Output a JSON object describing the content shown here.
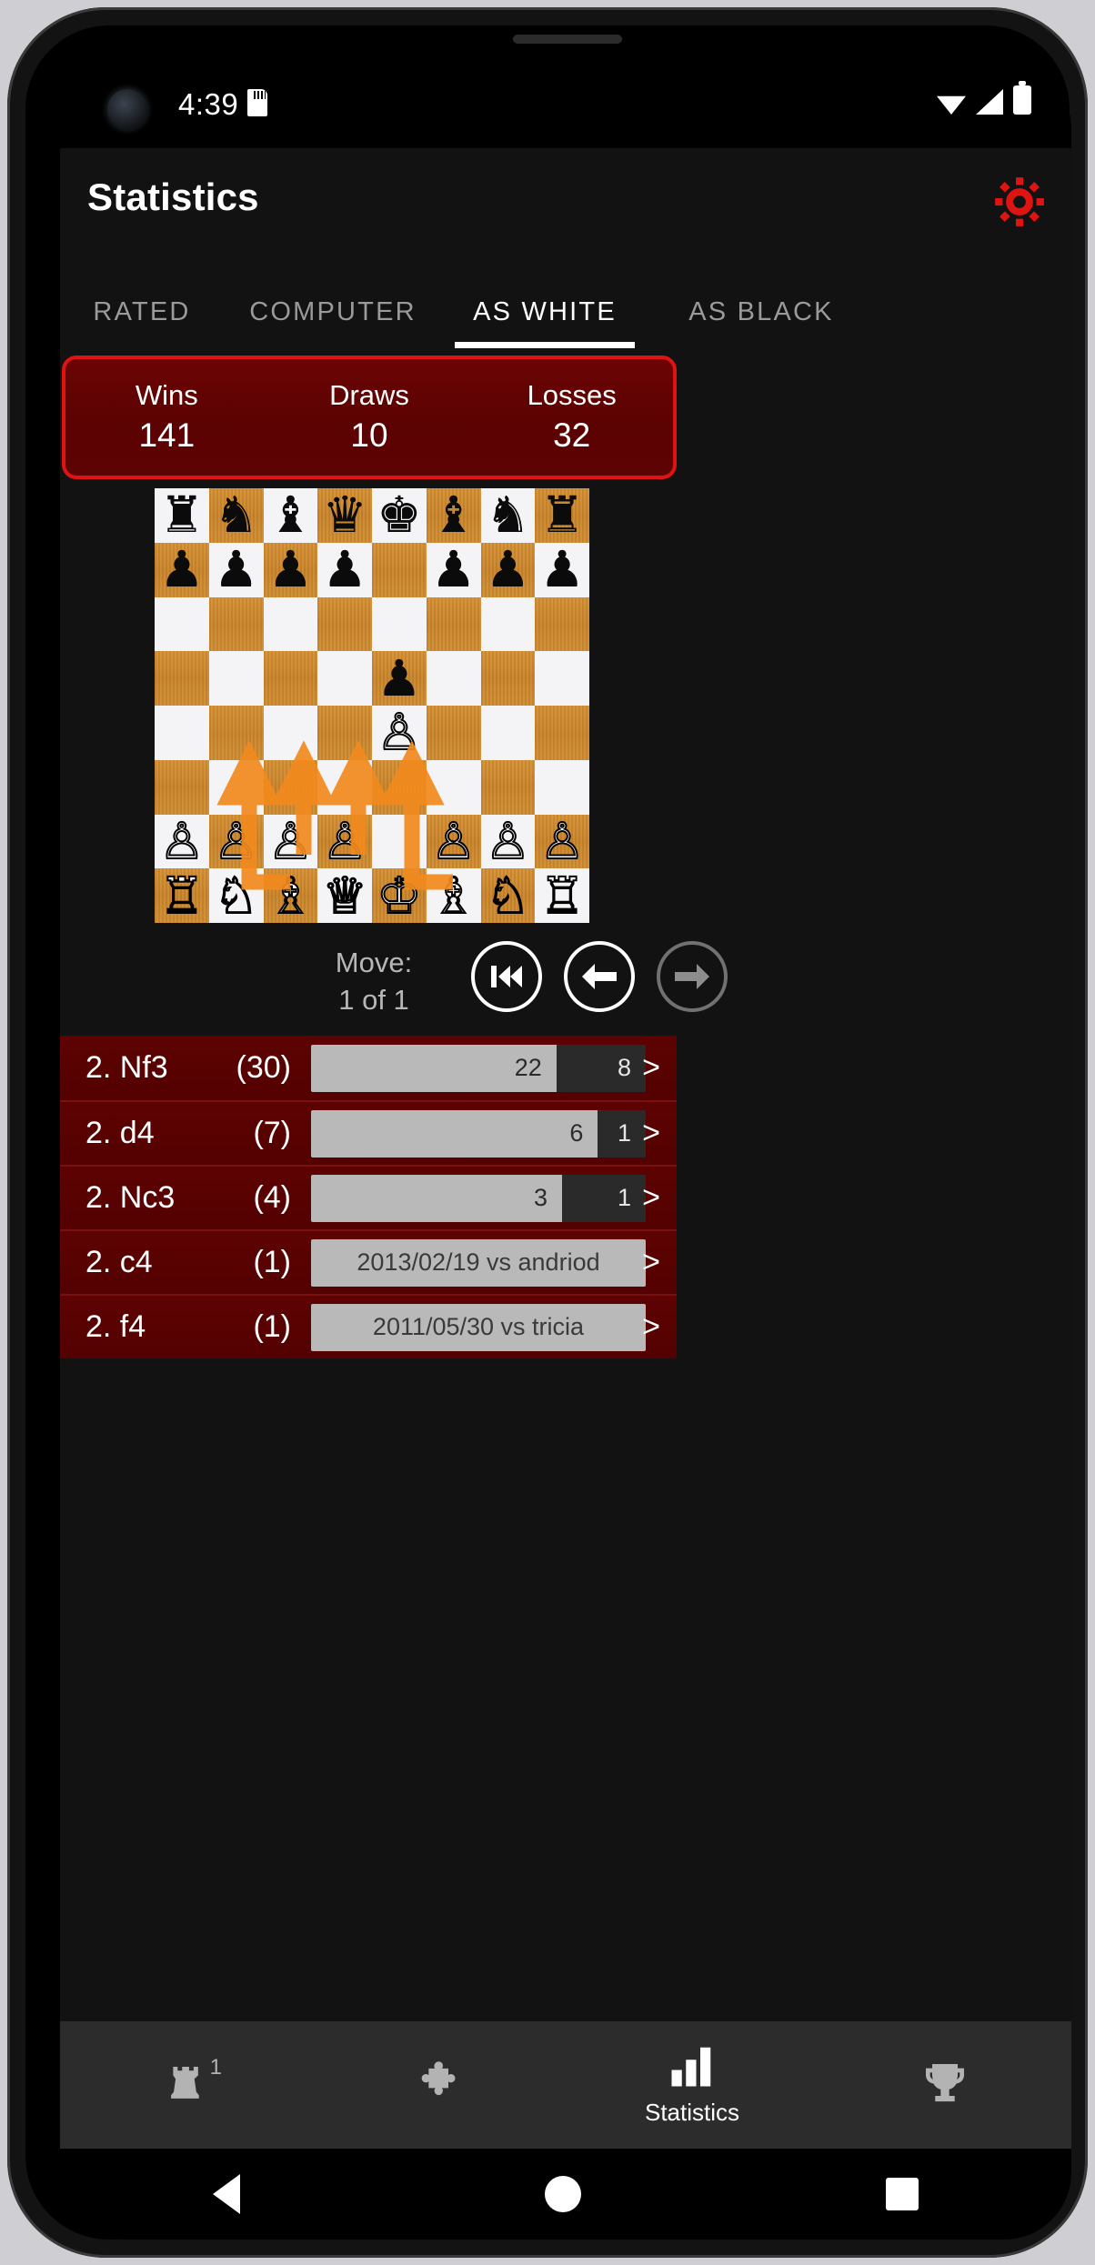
{
  "status_bar": {
    "time": "4:39",
    "icons": [
      "camera-lens",
      "sd-card-icon",
      "wifi-icon",
      "signal-icon",
      "battery-icon"
    ]
  },
  "app_bar": {
    "title": "Statistics",
    "settings_icon": "gear-icon",
    "accent_color": "#e01313"
  },
  "tabs": [
    {
      "label": "RATED",
      "active": false
    },
    {
      "label": "COMPUTER",
      "active": false
    },
    {
      "label": "AS WHITE",
      "active": true
    },
    {
      "label": "AS BLACK",
      "active": false
    }
  ],
  "stats": {
    "wins_label": "Wins",
    "wins_value": "141",
    "draws_label": "Draws",
    "draws_value": "10",
    "losses_label": "Losses",
    "losses_value": "32",
    "border_color": "#e01313",
    "background_color": "#5e0303"
  },
  "board": {
    "light_square_color": "#f4f4f6",
    "dark_square_color": "#cf8b2e",
    "arrow_color": "#f28a1e",
    "rows": [
      [
        "r",
        "n",
        "b",
        "q",
        "k",
        "b",
        "n",
        "r"
      ],
      [
        "p",
        "p",
        "p",
        "p",
        "",
        "p",
        "p",
        "p"
      ],
      [
        "",
        "",
        "",
        "",
        "",
        "",
        "",
        ""
      ],
      [
        "",
        "",
        "",
        "",
        "p",
        "",
        "",
        ""
      ],
      [
        "",
        "",
        "",
        "",
        "P",
        "",
        "",
        ""
      ],
      [
        "",
        "",
        "",
        "",
        "",
        "",
        "",
        ""
      ],
      [
        "P",
        "P",
        "P",
        "P",
        "",
        "P",
        "P",
        "P"
      ],
      [
        "R",
        "N",
        "B",
        "Q",
        "K",
        "B",
        "N",
        "R"
      ]
    ],
    "arrows": [
      {
        "from": "b1",
        "to": "c3"
      },
      {
        "from": "d2",
        "to": "d4"
      },
      {
        "from": "c2",
        "to": "c4"
      },
      {
        "from": "g1",
        "to": "f3"
      }
    ]
  },
  "move_nav": {
    "label_line1": "Move:",
    "label_line2": "1 of 1",
    "buttons": [
      {
        "name": "skip-to-start-icon",
        "enabled": true
      },
      {
        "name": "arrow-left-icon",
        "enabled": true
      },
      {
        "name": "arrow-right-icon",
        "enabled": false
      }
    ]
  },
  "move_list": [
    {
      "move": "2. Nf3",
      "count": "(30)",
      "kind": "bars",
      "win": "22",
      "loss": "8",
      "win_ratio": 0.733,
      "chevron": ">"
    },
    {
      "move": "2. d4",
      "count": "(7)",
      "kind": "bars",
      "win": "6",
      "loss": "1",
      "win_ratio": 0.857,
      "chevron": ">"
    },
    {
      "move": "2. Nc3",
      "count": "(4)",
      "kind": "bars",
      "win": "3",
      "loss": "1",
      "win_ratio": 0.75,
      "chevron": ">"
    },
    {
      "move": "2. c4",
      "count": "(1)",
      "kind": "text",
      "text": "2013/02/19 vs andriod",
      "chevron": ">"
    },
    {
      "move": "2. f4",
      "count": "(1)",
      "kind": "text",
      "text": "2011/05/30 vs tricia",
      "chevron": ">"
    }
  ],
  "bottom_nav": [
    {
      "icon": "rook-icon",
      "badge": "1",
      "label": "",
      "active": false
    },
    {
      "icon": "puzzle-icon",
      "badge": "",
      "label": "",
      "active": false
    },
    {
      "icon": "bar-chart-icon",
      "badge": "",
      "label": "Statistics",
      "active": true
    },
    {
      "icon": "trophy-icon",
      "badge": "",
      "label": "",
      "active": false
    }
  ],
  "system_nav": [
    "back-triangle-icon",
    "home-circle-icon",
    "recents-square-icon"
  ]
}
